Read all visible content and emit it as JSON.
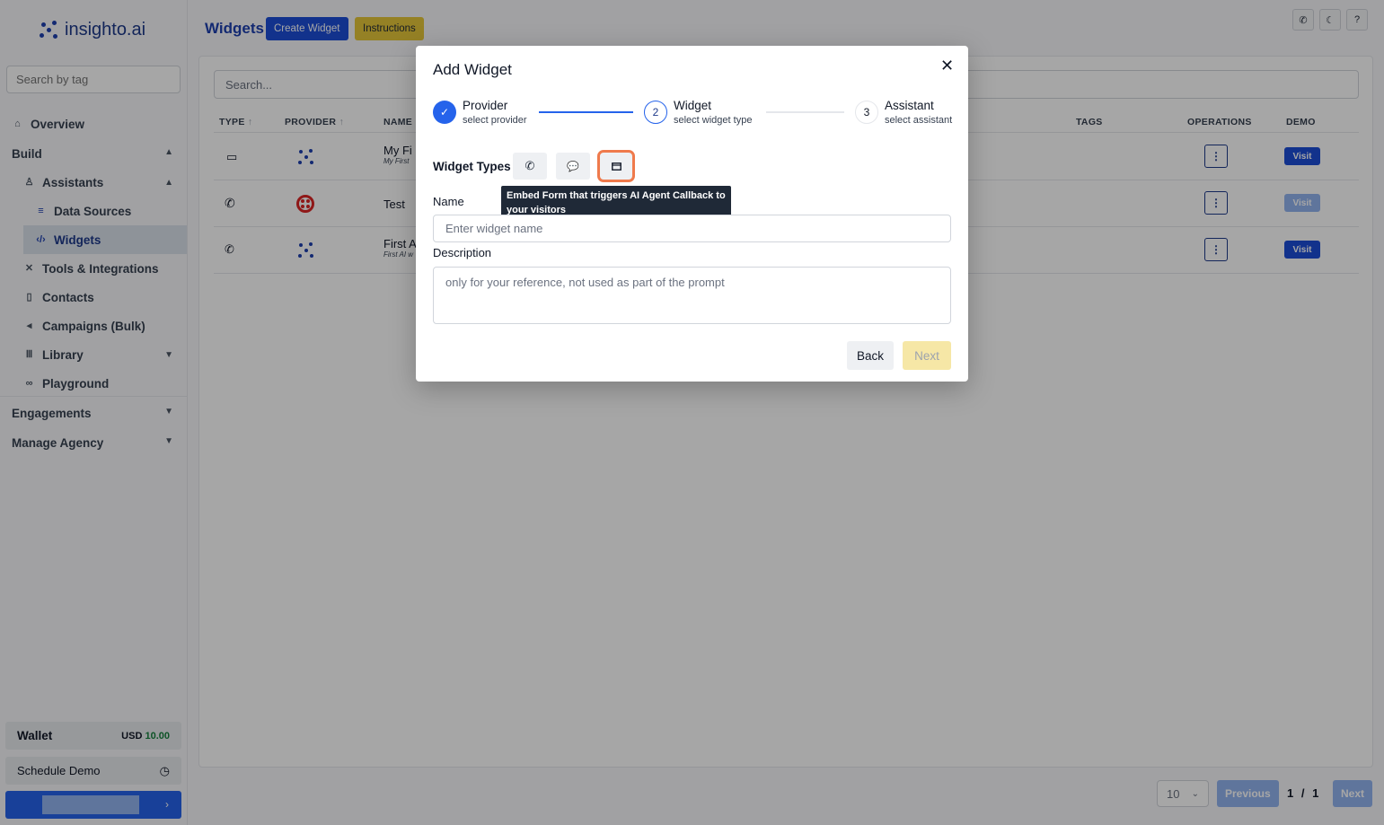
{
  "brand": {
    "name": "insighto.ai"
  },
  "sidebar": {
    "search_placeholder": "Search by tag",
    "overview": "Overview",
    "build": "Build",
    "assistants": "Assistants",
    "data_sources": "Data Sources",
    "widgets": "Widgets",
    "tools": "Tools & Integrations",
    "contacts": "Contacts",
    "campaigns": "Campaigns (Bulk)",
    "library": "Library",
    "playground": "Playground",
    "engagements": "Engagements",
    "manage_agency": "Manage Agency",
    "wallet_label": "Wallet",
    "wallet_currency": "USD",
    "wallet_amount": "10.00",
    "schedule_demo": "Schedule Demo"
  },
  "header": {
    "title": "Widgets",
    "create_label": "Create Widget",
    "instructions_label": "Instructions"
  },
  "table": {
    "search_placeholder": "Search...",
    "columns": {
      "type": "TYPE",
      "provider": "PROVIDER",
      "name": "NAME",
      "tags": "TAGS",
      "operations": "OPERATIONS",
      "demo": "DEMO"
    },
    "rows": [
      {
        "name": "My Fi",
        "sub": "My First",
        "visit": "Visit"
      },
      {
        "name": "Test",
        "sub": "",
        "visit": "Visit"
      },
      {
        "name": "First A",
        "sub": "First AI w",
        "visit": "Visit"
      }
    ]
  },
  "pagination": {
    "page_size": "10",
    "previous": "Previous",
    "page": "1",
    "separator": "/",
    "total": "1",
    "next": "Next"
  },
  "modal": {
    "title": "Add Widget",
    "steps": [
      {
        "number": "",
        "title": "Provider",
        "subtitle": "select provider",
        "status": "done"
      },
      {
        "number": "2",
        "title": "Widget",
        "subtitle": "select widget type",
        "status": "current"
      },
      {
        "number": "3",
        "title": "Assistant",
        "subtitle": "select assistant",
        "status": "pending"
      }
    ],
    "widget_types_label": "Widget Types",
    "tooltip": "Embed Form that triggers AI Agent Callback to your visitors",
    "name_label": "Name",
    "name_placeholder": "Enter widget name",
    "description_label": "Description",
    "description_placeholder": "only for your reference, not used as part of the prompt",
    "back_label": "Back",
    "next_label": "Next"
  },
  "colors": {
    "accent": "#1d4ed8",
    "highlight": "#ef7a4c",
    "instructions": "#e5c63a"
  }
}
